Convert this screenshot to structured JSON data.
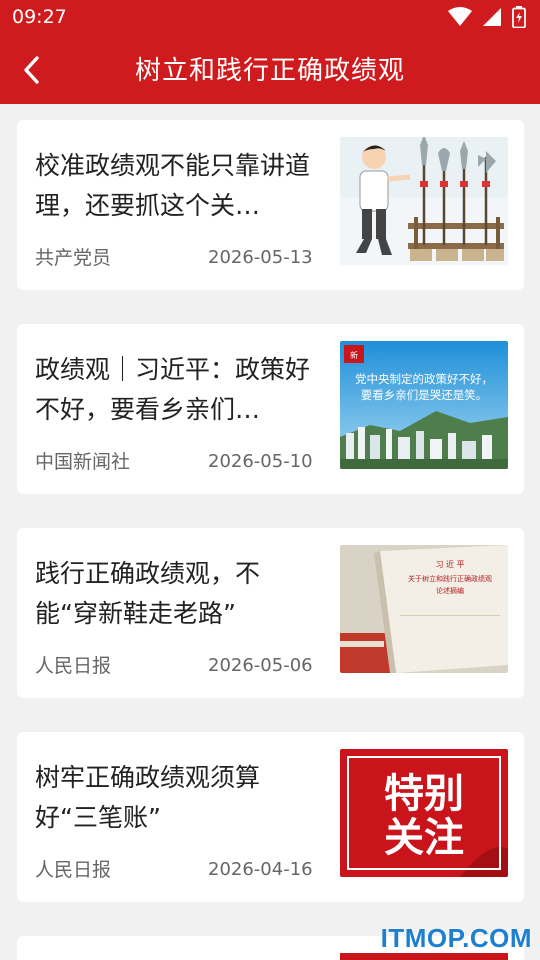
{
  "status_bar": {
    "time": "09:27"
  },
  "header": {
    "title": "树立和践行正确政绩观"
  },
  "articles": [
    {
      "title": "校准政绩观不能只靠讲道理，还要抓这个关…",
      "source": "共产党员",
      "date": "2026-05-13"
    },
    {
      "title": "政绩观｜习近平：政策好不好，要看乡亲们…",
      "source": "中国新闻社",
      "date": "2026-05-10",
      "thumb_text": [
        "党中央制定的政策好不好，",
        "要看乡亲们是哭还是笑。"
      ]
    },
    {
      "title": "践行正确政绩观，不能“穿新鞋走老路”",
      "source": "人民日报",
      "date": "2026-05-06",
      "thumb_text": [
        "习 近 平",
        "关于树立和践行正确政绩观",
        "论述摘编"
      ]
    },
    {
      "title": "树牢正确政绩观须算好“三笔账”",
      "source": "人民日报",
      "date": "2026-04-16",
      "thumb_text": [
        "特别",
        "关注"
      ]
    }
  ],
  "watermark": "ITMOP.COM",
  "colors": {
    "header": "#cf1b1d",
    "background": "#f1f1f1",
    "card": "#ffffff"
  }
}
